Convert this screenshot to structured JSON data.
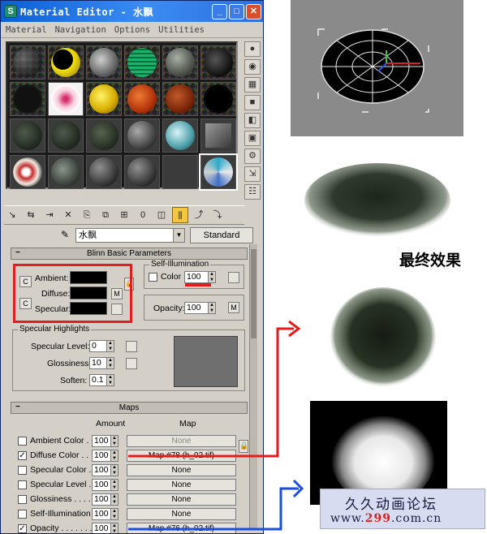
{
  "window": {
    "title": "Material Editor - 水飘",
    "menu": [
      "Material",
      "Navigation",
      "Options",
      "Utilities"
    ],
    "minimize": "_",
    "maximize": "□",
    "close": "✕"
  },
  "material": {
    "name": "水飘",
    "type_button": "Standard"
  },
  "blinn": {
    "rollout_title": "Blinn Basic Parameters",
    "ambient_label": "Ambient:",
    "diffuse_label": "Diffuse:",
    "specular_label": "Specular:",
    "self_illum_legend": "Self-Illumination",
    "color_label": "Color",
    "self_illum_value": "100",
    "opacity_label": "Opacity:",
    "opacity_value": "100",
    "m_label": "M",
    "c_label": "C"
  },
  "highlights": {
    "legend": "Specular Highlights",
    "specular_level_label": "Specular Level:",
    "specular_level_value": "0",
    "glossiness_label": "Glossiness:",
    "glossiness_value": "10",
    "soften_label": "Soften:",
    "soften_value": "0.1"
  },
  "maps": {
    "rollout_title": "Maps",
    "amount_header": "Amount",
    "map_header": "Map",
    "rows": [
      {
        "label": "Ambient Color . . .",
        "amount": "100",
        "map": "None",
        "checked": false
      },
      {
        "label": "Diffuse Color . . . .",
        "amount": "100",
        "map": "Map #78 (h_02.tif)",
        "checked": true
      },
      {
        "label": "Specular Color . .",
        "amount": "100",
        "map": "None",
        "checked": false
      },
      {
        "label": "Specular Level . .",
        "amount": "100",
        "map": "None",
        "checked": false
      },
      {
        "label": "Glossiness . . . . . .",
        "amount": "100",
        "map": "None",
        "checked": false
      },
      {
        "label": "Self-Illumination . .",
        "amount": "100",
        "map": "None",
        "checked": false
      },
      {
        "label": "Opacity . . . . . . . .",
        "amount": "100",
        "map": "Map #76 (h_02.tif)",
        "checked": true
      }
    ]
  },
  "caption": "最终效果",
  "watermark": {
    "site_name": "久久动画论坛",
    "url_prefix": "www.",
    "url_num": "299",
    "url_suffix": ".com.cn"
  },
  "colors": {
    "highlight_red": "#e41c1c",
    "arrow_blue": "#1b4ee0"
  }
}
